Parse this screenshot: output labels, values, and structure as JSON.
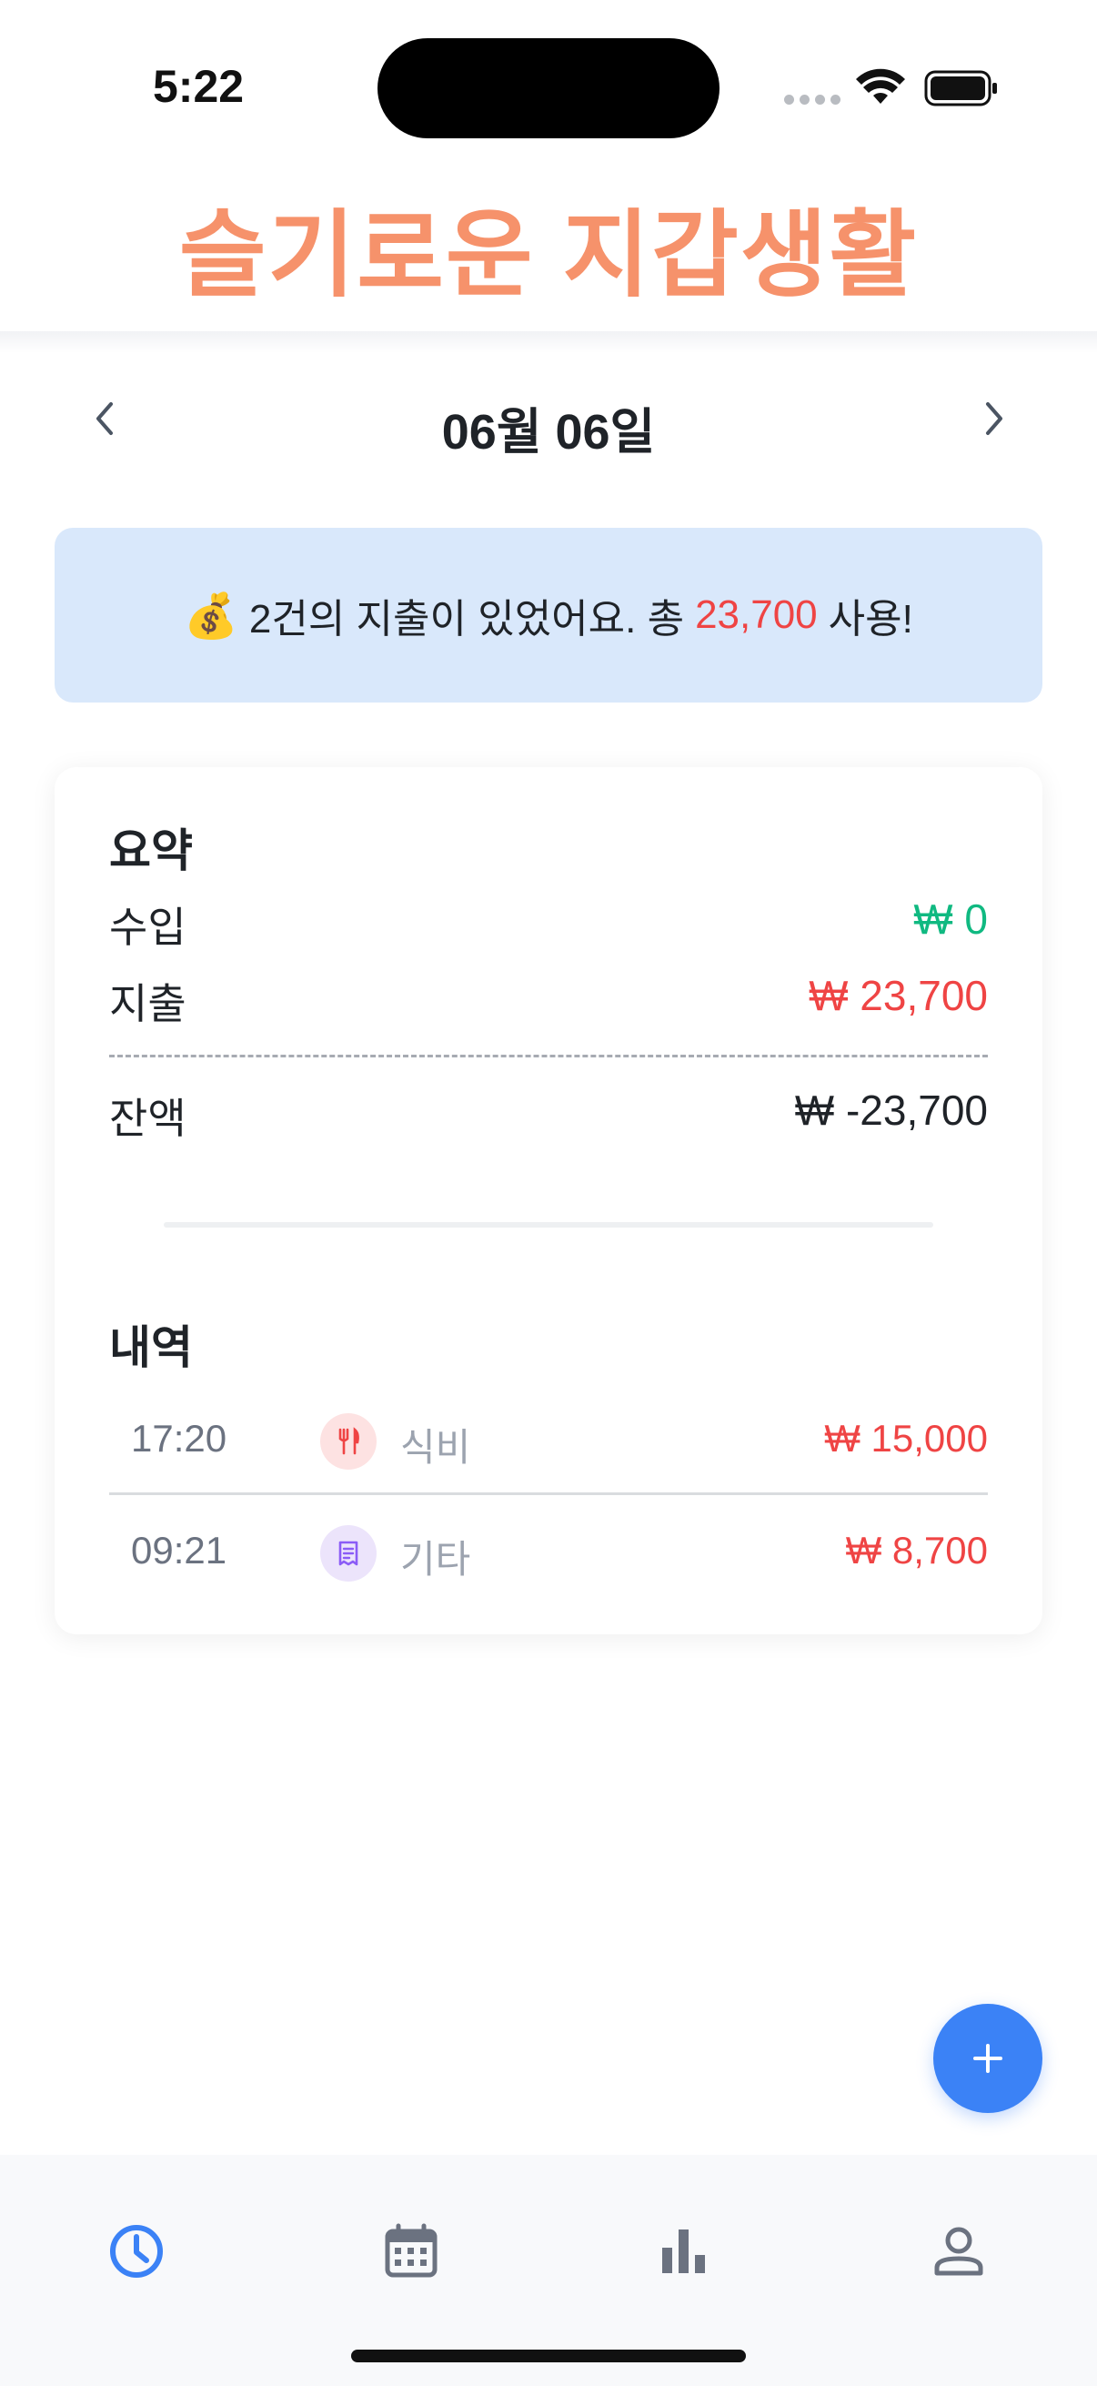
{
  "status_bar": {
    "time": "5:22"
  },
  "app": {
    "title": "슬기로운 지갑생활"
  },
  "date_nav": {
    "label": "06월 06일"
  },
  "banner": {
    "icon": "money-bag-icon",
    "text_before": "2건의 지출이 있었어요. 총",
    "amount": "23,700",
    "text_after": "사용!"
  },
  "summary": {
    "title": "요약",
    "income_label": "수입",
    "income_value": "₩ 0",
    "expense_label": "지출",
    "expense_value": "₩ 23,700",
    "balance_label": "잔액",
    "balance_value": "₩ -23,700"
  },
  "history": {
    "title": "내역",
    "items": [
      {
        "time": "17:20",
        "icon": "fork-knife-icon",
        "category": "식비",
        "amount": "₩ 15,000"
      },
      {
        "time": "09:21",
        "icon": "receipt-icon",
        "category": "기타",
        "amount": "₩ 8,700"
      }
    ]
  },
  "colors": {
    "brand": "#f6926b",
    "income": "#10b981",
    "expense": "#ef4444",
    "accent": "#3b82f6",
    "banner_bg": "#d9e8fb"
  },
  "tabs": [
    {
      "icon": "clock-icon",
      "active": true
    },
    {
      "icon": "calendar-icon",
      "active": false
    },
    {
      "icon": "bar-chart-icon",
      "active": false
    },
    {
      "icon": "person-icon",
      "active": false
    }
  ]
}
